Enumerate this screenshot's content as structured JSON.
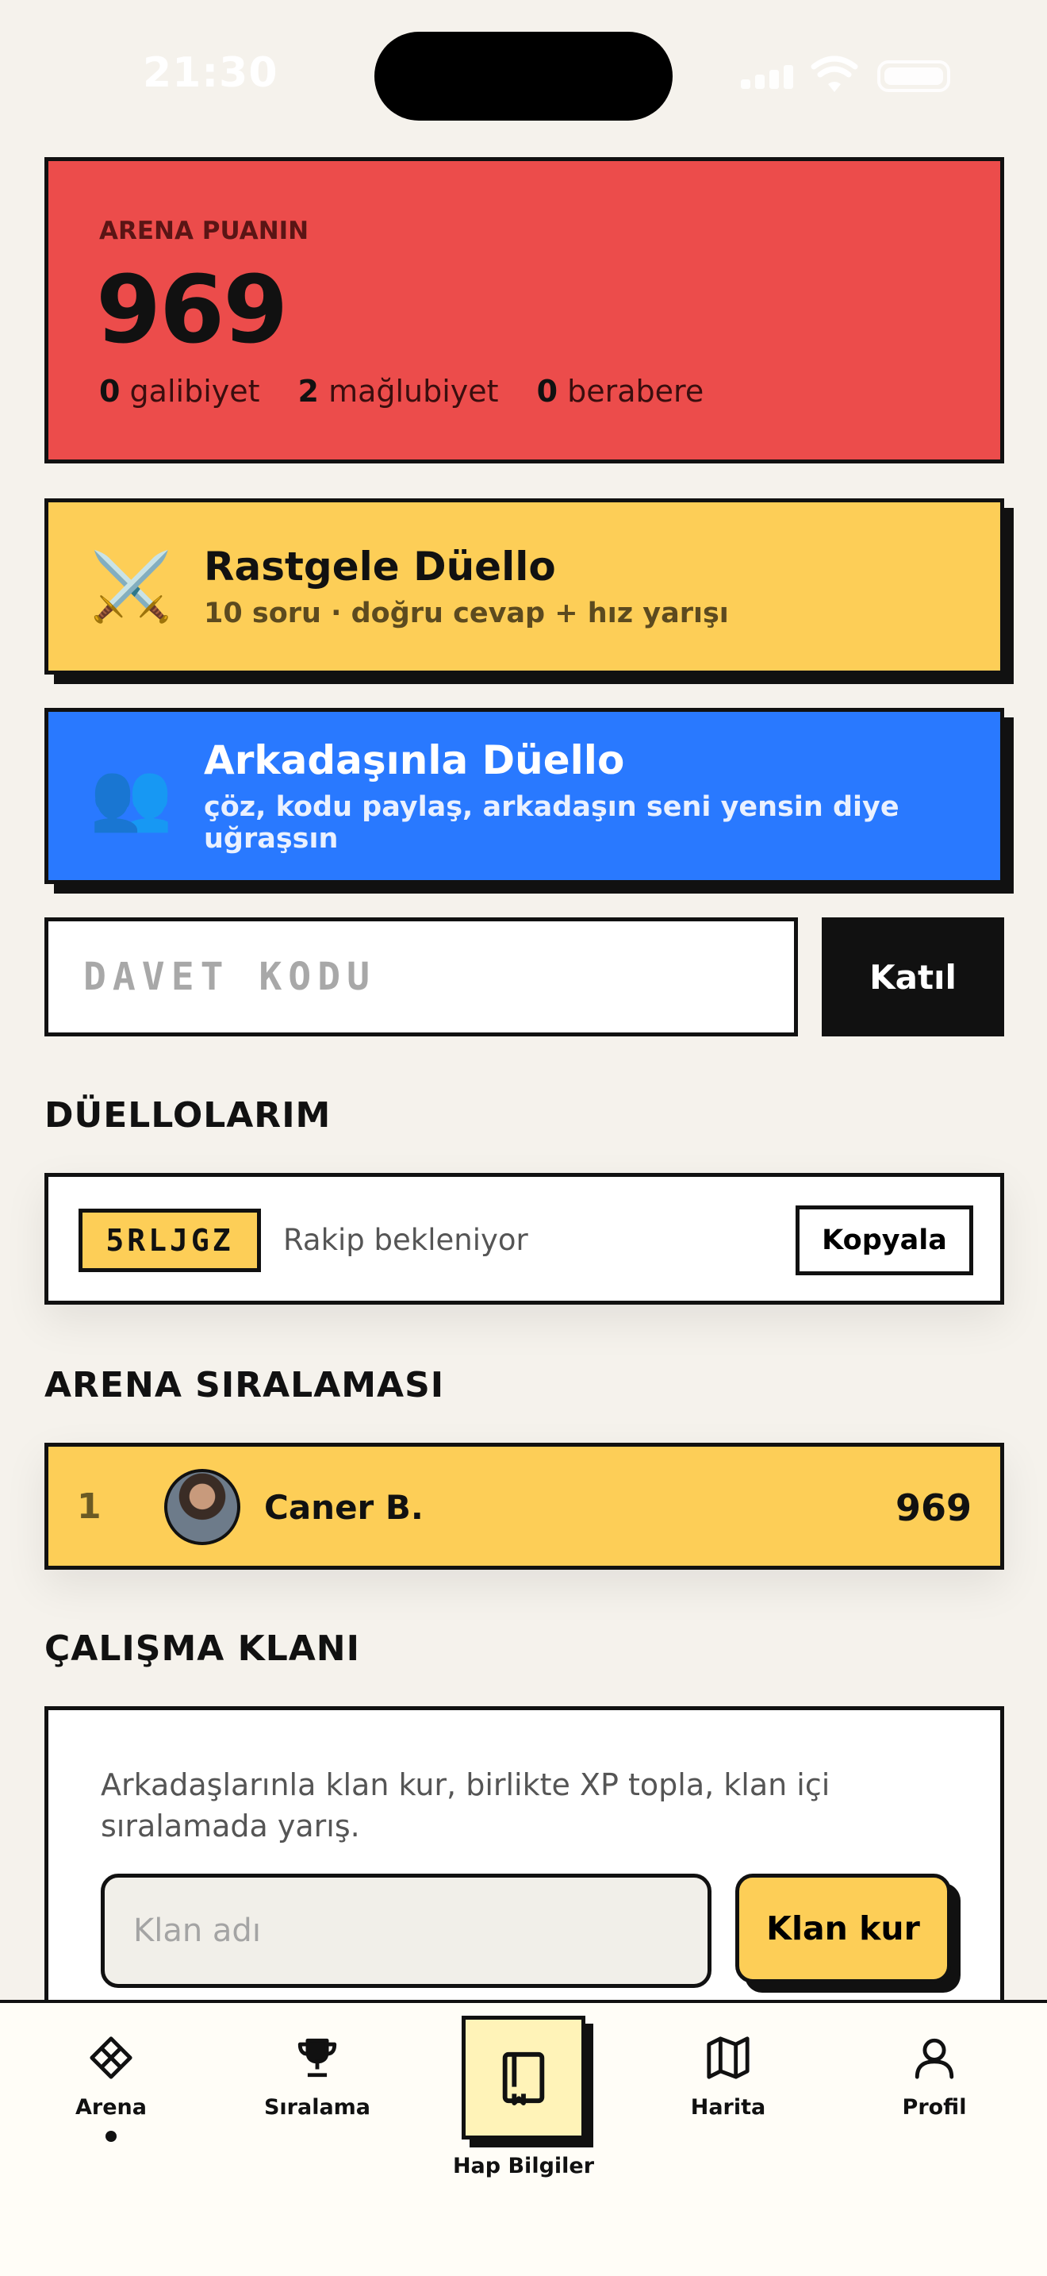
{
  "status_bar": {
    "time": "21:30"
  },
  "score_card": {
    "label": "ARENA PUANIN",
    "value": "969",
    "wins_value": "0",
    "wins_label": "galibiyet",
    "losses_value": "2",
    "losses_label": "mağlubiyet",
    "draws_value": "0",
    "draws_label": "berabere"
  },
  "random_duel": {
    "icon": "crossed-swords-icon",
    "title": "Rastgele Düello",
    "subtitle": "10 soru · doğru cevap + hız yarışı"
  },
  "friend_duel": {
    "icon": "two-people-icon",
    "title": "Arkadaşınla Düello",
    "subtitle": "çöz, kodu paylaş, arkadaşın seni yensin diye uğraşsın"
  },
  "invite": {
    "placeholder": "DAVET KODU",
    "join_label": "Katıl"
  },
  "my_duels": {
    "title": "DÜELLOLARIM",
    "items": [
      {
        "code": "5RLJGZ",
        "status": "Rakip bekleniyor",
        "copy_label": "Kopyala"
      }
    ]
  },
  "leaderboard": {
    "title": "ARENA SIRALAMASI",
    "items": [
      {
        "rank": "1",
        "name": "Caner B.",
        "score": "969"
      }
    ]
  },
  "clan": {
    "title": "ÇALIŞMA KLANI",
    "description": "Arkadaşlarınla klan kur, birlikte XP topla, klan içi sıralamada yarış.",
    "input_placeholder": "Klan adı",
    "button_label": "Klan kur"
  },
  "tab_bar": {
    "tabs": [
      {
        "label": "Arena",
        "icon": "arena-icon",
        "active": true
      },
      {
        "label": "Sıralama",
        "icon": "trophy-icon"
      },
      {
        "label": "Hap Bilgiler",
        "icon": "book-icon",
        "highlighted": true
      },
      {
        "label": "Harita",
        "icon": "map-icon"
      },
      {
        "label": "Profil",
        "icon": "user-icon"
      }
    ]
  },
  "colors": {
    "background": "#f5f2ec",
    "score_red": "#ec4c4b",
    "accent_yellow": "#fdce57",
    "accent_blue": "#2979ff",
    "ink": "#111111"
  }
}
